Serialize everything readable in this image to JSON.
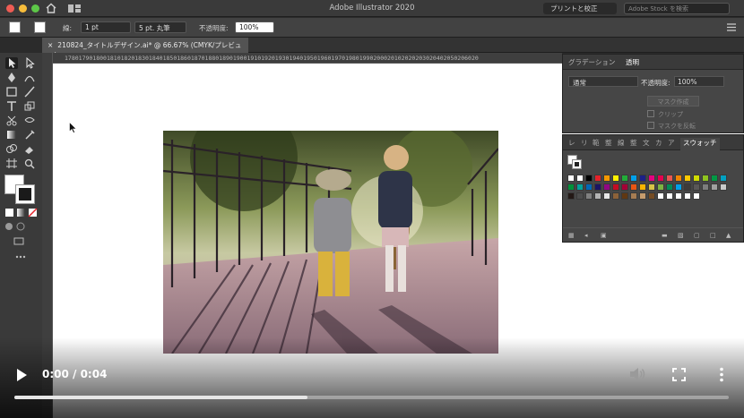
{
  "app": {
    "title": "Adobe Illustrator 2020",
    "workspace": "プリントと校正",
    "stock_search_placeholder": "Adobe Stock を検索"
  },
  "control_bar": {
    "stroke_label": "線:",
    "stroke_weight": "1 pt",
    "brush": "5 pt. 丸筆",
    "opacity_label": "不透明度:",
    "opacity_value": "100%"
  },
  "document_tab": {
    "close": "×",
    "name": "210824_タイトルデザイン.ai* @ 66.67% (CMYK/プレビュー)"
  },
  "ruler": {
    "ticks": "1780179018001810182018301840185018601870188018901900191019201930194019501960197019801990200020102020203020402050206020"
  },
  "transparency_panel": {
    "tabs": [
      "グラデーション",
      "透明"
    ],
    "blend_mode": "通常",
    "opacity_label": "不透明度:",
    "opacity_value": "100%",
    "make_mask_button": "マスク作成",
    "clip_label": "クリップ",
    "invert_label": "マスクを反転"
  },
  "swatches_panel": {
    "tabs": [
      "レ",
      "リ",
      "範",
      "整",
      "線",
      "整",
      "文",
      "カ",
      "ア",
      "スウォッチ"
    ],
    "colors": [
      [
        "#ffffff",
        "#ffffff",
        "#000000",
        "#e4222a",
        "#f39800",
        "#fff100",
        "#22ac38",
        "#00a0e9",
        "#1d2088",
        "#e4007f",
        "#e5004f",
        "#ea5550",
        "#f08300",
        "#fcc800",
        "#cfdb00",
        "#8fc31f",
        "#009944",
        "#00a0c1"
      ],
      [
        "#00913a",
        "#00a29a",
        "#0068b7",
        "#1b1464",
        "#920783",
        "#c30d23",
        "#a40035",
        "#e95513",
        "#f8b500",
        "#d7c447",
        "#7cb342",
        "#008c57",
        "#00a0e9",
        "#3e3a39",
        "#595757",
        "#7d7d7d",
        "#a0a0a0",
        "#c9caca"
      ],
      [
        "#231815",
        "#4d4d4d",
        "#808080",
        "#b3b3b3",
        "#e6e6e6",
        "#8c6239",
        "#603813",
        "#a67c52",
        "#c69c6d",
        "#754c24",
        "#ffffff",
        "#ffffff",
        "#ffffff",
        "#ffffff",
        "#ffffff"
      ]
    ]
  },
  "video": {
    "time": "0:00 / 0:04",
    "progress": 0.41
  }
}
